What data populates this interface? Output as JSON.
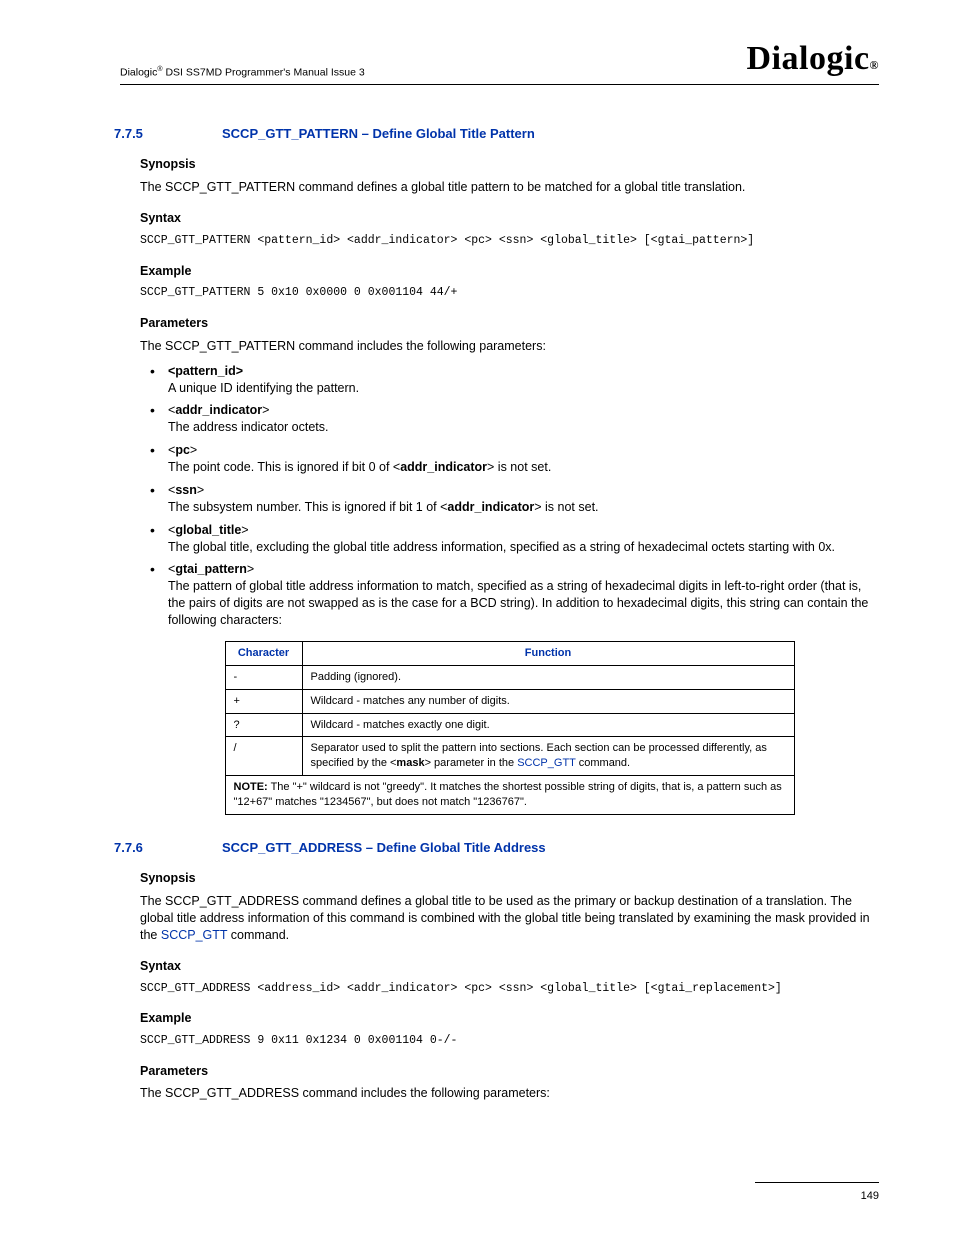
{
  "header": {
    "left_pre": "Dialogic",
    "left_sup": "®",
    "left_post": " DSI SS7MD Programmer's Manual   Issue 3",
    "brand_main": "Dialogic",
    "brand_sub": "®"
  },
  "s1": {
    "num": "7.7.5",
    "title": "SCCP_GTT_PATTERN – Define Global Title Pattern",
    "synopsis_h": "Synopsis",
    "synopsis": "The SCCP_GTT_PATTERN command defines a global title pattern to be matched for a global title translation.",
    "syntax_h": "Syntax",
    "syntax": "SCCP_GTT_PATTERN <pattern_id> <addr_indicator> <pc> <ssn> <global_title> [<gtai_pattern>]",
    "example_h": "Example",
    "example": "SCCP_GTT_PATTERN 5 0x10 0x0000 0 0x001104 44/+",
    "params_h": "Parameters",
    "params_intro": "The SCCP_GTT_PATTERN command includes the following parameters:",
    "p1_name": "<pattern_id>",
    "p1_desc": "A unique ID identifying the pattern.",
    "p2_name_b": "addr_indicator",
    "p2_desc": "The address indicator octets.",
    "p3_name_b": "pc",
    "p3_desc_a": "The point code. This is ignored if bit 0 of <",
    "p3_desc_b": "addr_indicator",
    "p3_desc_c": "> is not set.",
    "p4_name_b": "ssn",
    "p4_desc_a": "The subsystem number. This is ignored if bit 1 of <",
    "p4_desc_b": "addr_indicator",
    "p4_desc_c": "> is not set.",
    "p5_name_b": "global_title",
    "p5_desc": "The global title, excluding the global title address information, specified as a string of hexadecimal octets starting with 0x.",
    "p6_name_b": "gtai_pattern",
    "p6_desc": "The pattern of global title address information to match, specified as a string of hexadecimal digits in left-to-right order (that is, the pairs of digits are not swapped as is the case for a BCD string). In addition to hexadecimal digits, this string can contain the following characters:",
    "th1": "Character",
    "th2": "Function",
    "r1c1": "-",
    "r1c2": "Padding (ignored).",
    "r2c1": "+",
    "r2c2": "Wildcard - matches any number of digits.",
    "r3c1": "?",
    "r3c2": "Wildcard - matches exactly one digit.",
    "r4c1": "/",
    "r4c2_a": "Separator used to split the pattern into sections. Each section can be processed differently, as specified by the <",
    "r4c2_b": "mask",
    "r4c2_c": "> parameter in the ",
    "r4c2_link": "SCCP_GTT",
    "r4c2_d": " command.",
    "note_label": "NOTE:",
    "note_text": "  The \"+\" wildcard is not \"greedy\". It matches the shortest possible string of digits, that is, a pattern such as \"12+67\" matches \"1234567\", but does not match \"1236767\"."
  },
  "s2": {
    "num": "7.7.6",
    "title": "SCCP_GTT_ADDRESS – Define Global Title Address",
    "synopsis_h": "Synopsis",
    "synopsis_a": "The SCCP_GTT_ADDRESS command defines a global title to be used as the primary or backup destination of a translation. The global title address information of this command is combined with the global title being translated by examining the mask provided in the ",
    "synopsis_link": "SCCP_GTT",
    "synopsis_b": " command.",
    "syntax_h": "Syntax",
    "syntax": "SCCP_GTT_ADDRESS <address_id> <addr_indicator> <pc> <ssn> <global_title> [<gtai_replacement>]",
    "example_h": "Example",
    "example": "SCCP_GTT_ADDRESS 9 0x11 0x1234 0 0x001104 0-/-",
    "params_h": "Parameters",
    "params_intro": "The SCCP_GTT_ADDRESS command includes the following parameters:"
  },
  "footer": {
    "page": "149"
  }
}
